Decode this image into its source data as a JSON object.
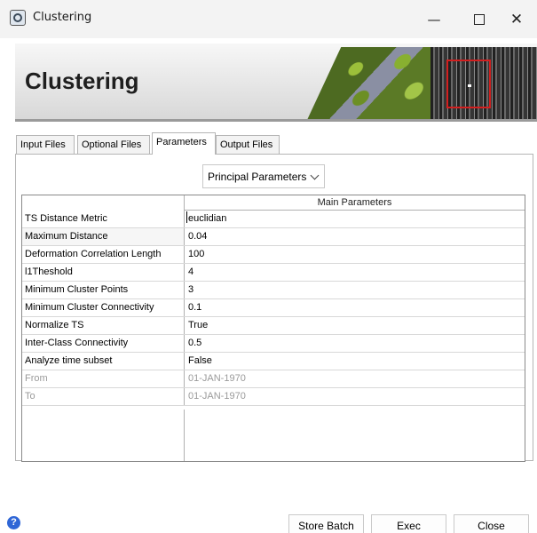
{
  "window": {
    "title": "Clustering",
    "minimize_glyph": "—",
    "close_glyph": "✕"
  },
  "banner": {
    "title": "Clustering"
  },
  "tabs": [
    {
      "label": "Input Files",
      "active": false
    },
    {
      "label": "Optional Files",
      "active": false
    },
    {
      "label": "Parameters",
      "active": true
    },
    {
      "label": "Output Files",
      "active": false
    }
  ],
  "dropdown": {
    "selected": "Principal Parameters"
  },
  "table": {
    "header_main": "Main Parameters",
    "rows": [
      {
        "name": "TS Distance Metric",
        "value": "euclidian"
      },
      {
        "name": "Maximum Distance",
        "value": "0.04"
      },
      {
        "name": "Deformation Correlation Length",
        "value": "100"
      },
      {
        "name": "l1Theshold",
        "value": "4"
      },
      {
        "name": "Minimum Cluster Points",
        "value": "3"
      },
      {
        "name": "Minimum Cluster Connectivity",
        "value": "0.1"
      },
      {
        "name": "Normalize TS",
        "value": "True"
      },
      {
        "name": "Inter-Class Connectivity",
        "value": "0.5"
      },
      {
        "name": "Analyze time subset",
        "value": "False"
      },
      {
        "name": "From",
        "value": "01-JAN-1970"
      },
      {
        "name": "To",
        "value": "01-JAN-1970"
      }
    ]
  },
  "buttons": {
    "help": "?",
    "store_batch": "Store Batch",
    "exec": "Exec",
    "close": "Close"
  },
  "colors": {
    "help_icon": "#2f66d6",
    "sar_box": "#d21f1f",
    "disabled_text": "#9a9a9a"
  }
}
